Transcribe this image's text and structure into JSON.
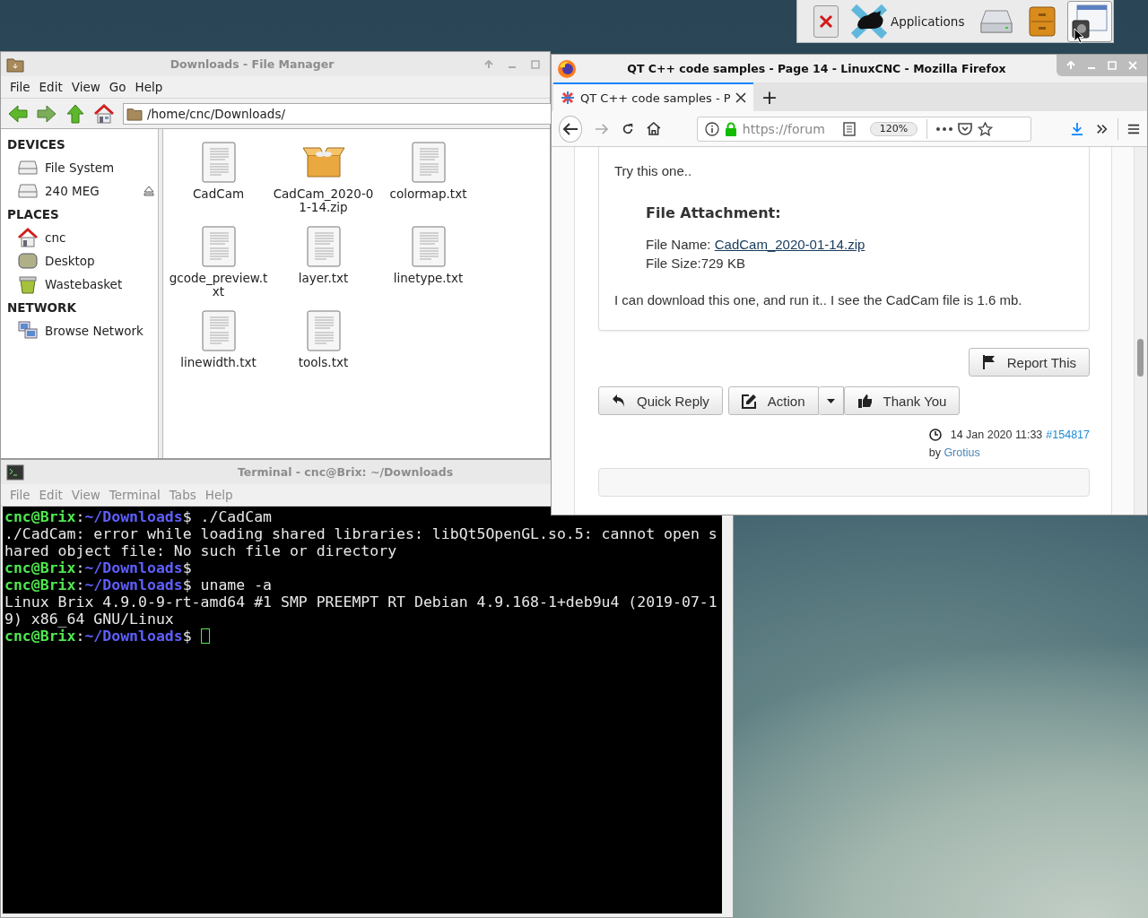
{
  "panel": {
    "items": [
      {
        "kind": "close",
        "selected": false
      },
      {
        "kind": "menu",
        "label": "Applications",
        "selected": false
      },
      {
        "kind": "drive",
        "selected": false
      },
      {
        "kind": "cabinet",
        "selected": false
      },
      {
        "kind": "windows",
        "selected": true
      }
    ]
  },
  "file_manager": {
    "title": "Downloads - File Manager",
    "focused": false,
    "menu": [
      "File",
      "Edit",
      "View",
      "Go",
      "Help"
    ],
    "location": "/home/cnc/Downloads/",
    "sidebar": [
      {
        "heading": "DEVICES",
        "items": [
          {
            "label": "File System",
            "kind": "drive"
          },
          {
            "label": "240 MEG",
            "kind": "removable"
          }
        ]
      },
      {
        "heading": "PLACES",
        "items": [
          {
            "label": "cnc",
            "kind": "home"
          },
          {
            "label": "Desktop",
            "kind": "desktop"
          },
          {
            "label": "Wastebasket",
            "kind": "trash"
          }
        ]
      },
      {
        "heading": "NETWORK",
        "items": [
          {
            "label": "Browse Network",
            "kind": "network"
          }
        ]
      }
    ],
    "files": [
      {
        "name": "CadCam",
        "kind": "text"
      },
      {
        "name": "CadCam_2020-01-14.zip",
        "kind": "archive"
      },
      {
        "name": "colormap.txt",
        "kind": "text"
      },
      {
        "name": "gcode_preview.txt",
        "kind": "text"
      },
      {
        "name": "layer.txt",
        "kind": "text"
      },
      {
        "name": "linetype.txt",
        "kind": "text"
      },
      {
        "name": "linewidth.txt",
        "kind": "text"
      },
      {
        "name": "tools.txt",
        "kind": "text"
      }
    ]
  },
  "terminal": {
    "title": "Terminal - cnc@Brix: ~/Downloads",
    "focused": false,
    "menu": [
      "File",
      "Edit",
      "View",
      "Terminal",
      "Tabs",
      "Help"
    ],
    "lines": [
      {
        "kind": "prompt",
        "user": "cnc@Brix",
        "sep": ":",
        "path": "~/Downloads",
        "sign": "$",
        "command": "./CadCam",
        "cursor": false
      },
      {
        "kind": "output",
        "text": "./CadCam: error while loading shared libraries: libQt5OpenGL.so.5: cannot open s",
        "cursor": false
      },
      {
        "kind": "output",
        "text": "hared object file: No such file or directory",
        "cursor": false
      },
      {
        "kind": "prompt",
        "user": "cnc@Brix",
        "sep": ":",
        "path": "~/Downloads",
        "sign": "$",
        "cursor": false
      },
      {
        "kind": "prompt",
        "user": "cnc@Brix",
        "sep": ":",
        "path": "~/Downloads",
        "sign": "$",
        "command": "uname -a",
        "cursor": false
      },
      {
        "kind": "output",
        "text": "Linux Brix 4.9.0-9-rt-amd64 #1 SMP PREEMPT RT Debian 4.9.168-1+deb9u4 (2019-07-1",
        "cursor": false
      },
      {
        "kind": "output",
        "text": "9) x86_64 GNU/Linux",
        "cursor": false
      },
      {
        "kind": "prompt",
        "user": "cnc@Brix",
        "sep": ":",
        "path": "~/Downloads",
        "sign": "$",
        "cursor": true
      }
    ]
  },
  "browser": {
    "title": "QT C++ code samples - Page 14 - LinuxCNC - Mozilla Firefox",
    "focused": true,
    "tabs": [
      {
        "title": "QT C++ code samples - P",
        "selected": true
      }
    ],
    "new_tab": "+",
    "url": "https://forum",
    "zoom": "120%",
    "post": {
      "intro": "Try this one..",
      "attachment_heading": "File Attachment:",
      "file_name_label": "File Name:",
      "file_name": "CadCam_2020-01-14.zip",
      "file_size": "File Size:729 KB",
      "body": "I can download this one, and run it.. I see the CadCam file is 1.6 mb."
    },
    "report": "Report This",
    "quick_reply": "Quick Reply",
    "action": "Action",
    "thank_you": "Thank You",
    "time": "14 Jan 2020 11:33",
    "post_number": "#154817",
    "by": "by",
    "author": "Grotius"
  }
}
